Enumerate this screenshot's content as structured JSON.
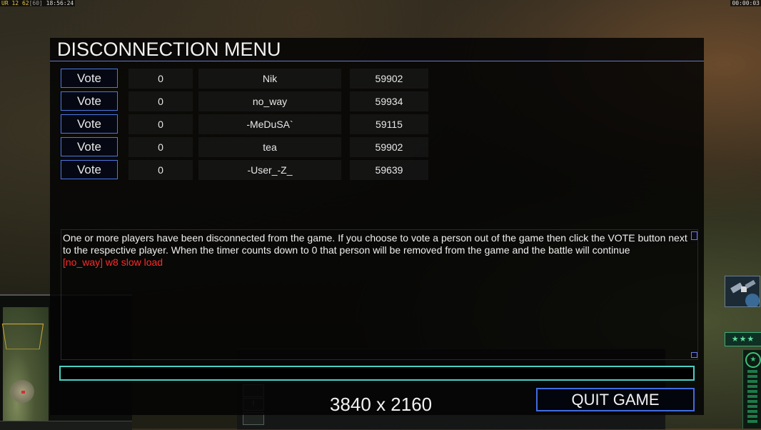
{
  "hud": {
    "top_left": {
      "prefix": "UR",
      "num1": "12",
      "fps": "62",
      "fps_max": "[60]",
      "clock": "18:56:24"
    },
    "top_right_timer": "00:00:03",
    "rank_stars": "★★★"
  },
  "dialog": {
    "title": "DISCONNECTION MENU",
    "vote_label": "Vote",
    "players": [
      {
        "votes": "0",
        "name": "Nik",
        "ping": "59902"
      },
      {
        "votes": "0",
        "name": "no_way",
        "ping": "59934"
      },
      {
        "votes": "0",
        "name": "-MeDuSA`",
        "ping": "59115"
      },
      {
        "votes": "0",
        "name": "tea",
        "ping": "59902"
      },
      {
        "votes": "0",
        "name": "-User_-Z_",
        "ping": "59639"
      }
    ],
    "info_text": "One or more players have been disconnected from the game. If you choose to vote a person out of the game then click the VOTE button next to the respective player. When the timer counts down to 0 that person will be removed from the game and the battle will continue",
    "chat_message": "[no_way] w8 slow load",
    "chat_input_value": "",
    "quit_label": "QUIT GAME"
  },
  "overlay": {
    "resolution": "3840 x 2160"
  },
  "colors": {
    "accent_blue": "#4a78e8",
    "chat_input_border": "#4ad0c4",
    "chat_message": "#ff2a2a"
  }
}
